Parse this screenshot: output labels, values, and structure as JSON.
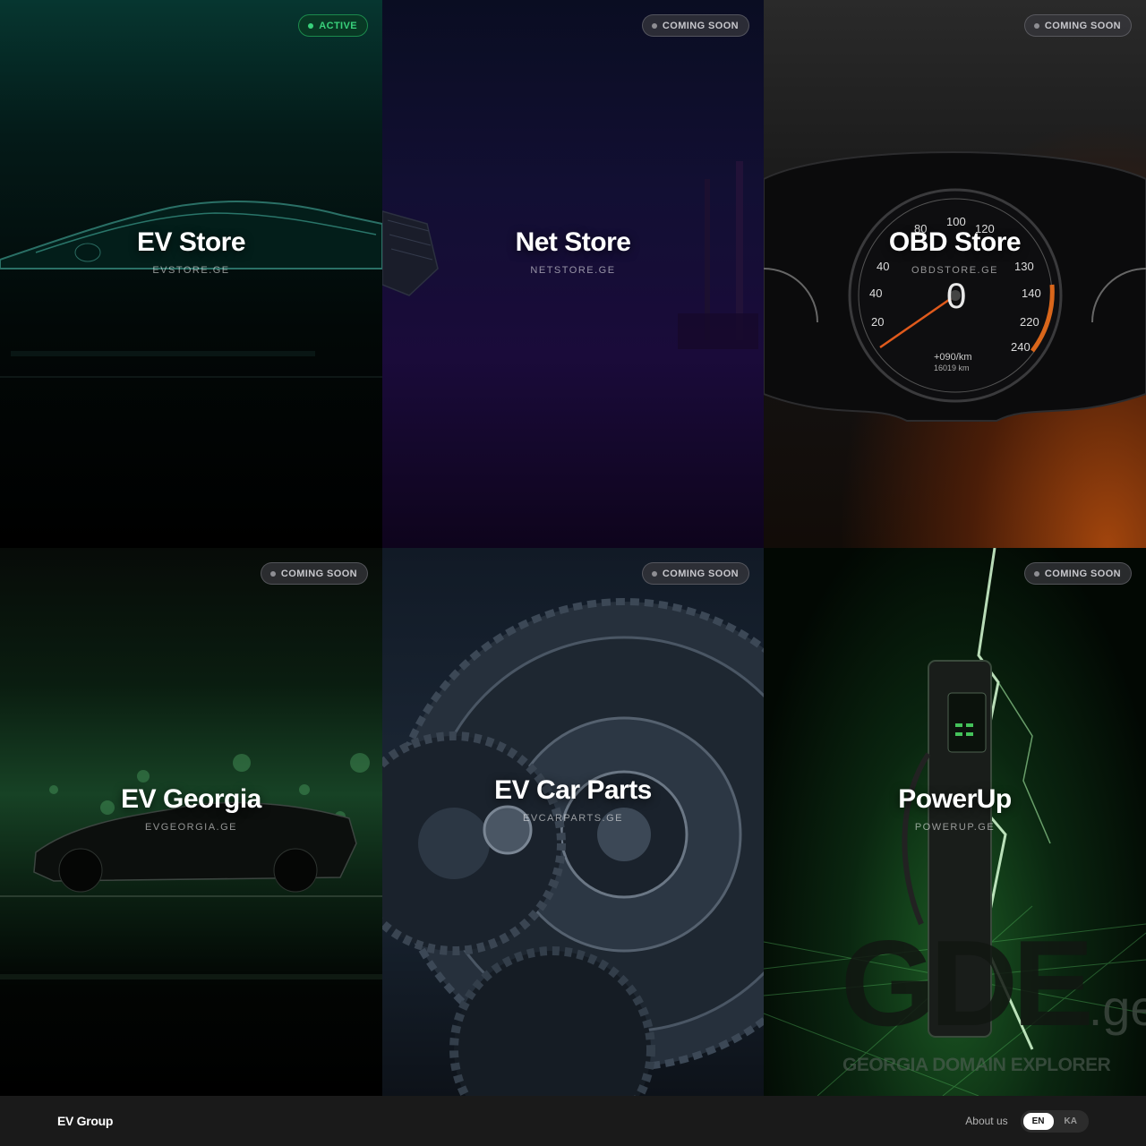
{
  "tiles": [
    {
      "title": "EV Store",
      "domain": "EVSTORE.GE",
      "status": "ACTIVE"
    },
    {
      "title": "Net Store",
      "domain": "NETSTORE.GE",
      "status": "COMING SOON"
    },
    {
      "title": "OBD Store",
      "domain": "OBDSTORE.GE",
      "status": "COMING SOON"
    },
    {
      "title": "EV Georgia",
      "domain": "EVGEORGIA.GE",
      "status": "COMING SOON"
    },
    {
      "title": "EV Car Parts",
      "domain": "EVCARPARTS.GE",
      "status": "COMING SOON"
    },
    {
      "title": "PowerUp",
      "domain": "POWERUP.GE",
      "status": "COMING SOON"
    }
  ],
  "gauge": {
    "ticks": [
      "80",
      "100",
      "120",
      "40",
      "130",
      "40",
      "140",
      "20",
      "220",
      "240"
    ],
    "speed": "0",
    "odo": "+090/km",
    "trip": "16019 km"
  },
  "watermark": {
    "text": "GDE",
    "suffix": ".ge",
    "subtitle": "GEORGIA DOMAIN EXPLORER"
  },
  "footer": {
    "brand": "EV Group",
    "about": "About us",
    "languages": [
      "EN",
      "KA"
    ],
    "active_language": "EN"
  },
  "colors": {
    "active": "#39d17b",
    "soon": "#c7c7cc",
    "footer_bg": "#1a1a1a"
  }
}
